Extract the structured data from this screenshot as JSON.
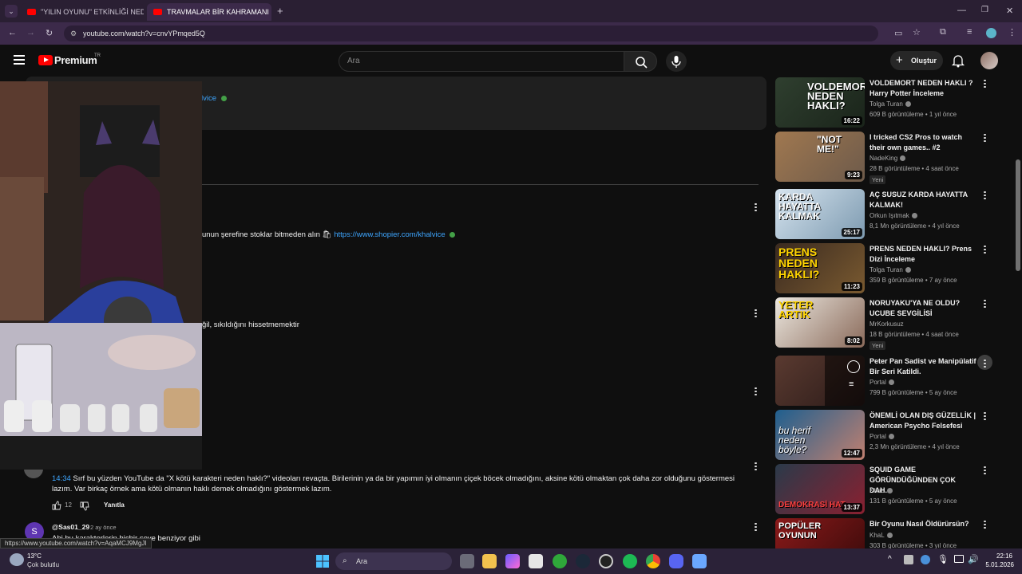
{
  "browser": {
    "tabs": [
      {
        "label": "\"YILIN OYUNU\" ETKİNLİĞİ NED..."
      },
      {
        "label": "TRAVMALAR BİR KAHRAMANI ..."
      }
    ],
    "url": "youtube.com/watch?v=cnvYPmqed5Q",
    "status_url": "https://www.youtube.com/watch?v=AqaMCJ9MgJI"
  },
  "youtube": {
    "logo": "Premium",
    "logo_region": "TR",
    "search_placeholder": "Ara",
    "create_label": "Oluştur"
  },
  "main": {
    "pinned_link_fragment": "lvice",
    "comment1_text": "unun şerefine stoklar bitmeden alın 🛍 ",
    "comment1_link": "https://www.shopier.com/khalvice",
    "comment2_text": "ğil, sıkıldığını  hissetmemektir",
    "comment3": {
      "timestamp": "14:34",
      "text": " Sırf bu yüzden YouTube da \"X kötü karakteri neden haklı?\" videoları revaçta. Birilerinin ya da bir yapımın iyi olmanın çiçek böcek olmadığını, aksine kötü olmaktan çok daha zor olduğunu göstermesi lazım. Var birkaç örnek ama kötü olmanın haklı demek olmadığını göstermek lazım.",
      "likes": "12",
      "reply_label": "Yanıtla"
    },
    "comment4": {
      "author": "@Sas01_29",
      "time": "2 ay önce",
      "avatar_letter": "S",
      "text": "Abi bu karakterlerin hiçbir şeye benziyor gibi"
    }
  },
  "sidebar": {
    "videos": [
      {
        "title": "VOLDEMORT NEDEN HAKLI ? Harry Potter İnceleme",
        "channel": "Tolga Turan",
        "meta": "609 B görüntüleme • 1 yıl önce",
        "duration": "16:22",
        "thumb_text": "VOLDEMORT NEDEN HAKLI?",
        "badge": ""
      },
      {
        "title": "I tricked CS2 Pros to watch their own games.. #2",
        "channel": "NadeKing",
        "meta": "28 B görüntüleme • 4 saat önce",
        "duration": "9:23",
        "thumb_text": "\"NOT ME!\"",
        "badge": "Yeni"
      },
      {
        "title": "AÇ SUSUZ KARDA HAYATTA KALMAK!",
        "channel": "Orkun Işıtmak",
        "meta": "8,1 Mn görüntüleme • 4 yıl önce",
        "duration": "25:17",
        "thumb_text": "KARDA HAYATTA KALMAK",
        "badge": ""
      },
      {
        "title": "PRENS NEDEN HAKLI? Prens Dizi İnceleme",
        "channel": "Tolga Turan",
        "meta": "359 B görüntüleme • 7 ay önce",
        "duration": "11:23",
        "thumb_text": "PRENS NEDEN HAKLI?",
        "badge": ""
      },
      {
        "title": "NORUYAKU'YA NE OLDU? UCUBE SEVGİLİSİ",
        "channel": "MrKorkusuz",
        "meta": "18 B görüntüleme • 4 saat önce",
        "duration": "8:02",
        "thumb_text": "YETER ARTIK",
        "badge": "Yeni"
      },
      {
        "title": "Peter Pan Sadist ve Manipülatif Bir Seri Katildi.",
        "channel": "Portal",
        "meta": "799 B görüntüleme • 5 ay önce",
        "duration": "",
        "thumb_text": "",
        "badge": ""
      },
      {
        "title": "ÖNEMLİ OLAN DIŞ GÜZELLİK | American Psycho Felsefesi",
        "channel": "Portal",
        "meta": "2,3 Mn görüntüleme • 4 yıl önce",
        "duration": "12:47",
        "thumb_text": "bu herif neden böyle?",
        "badge": ""
      },
      {
        "title": "SQUID GAME GÖRÜNDÜĞÜNDEN ÇOK DAH...",
        "channel": "KhaL",
        "meta": "131 B görüntüleme • 5 ay önce",
        "duration": "13:37",
        "thumb_text": "DEMOKRASİ HAT",
        "badge": ""
      },
      {
        "title": "Bir Oyunu Nasıl Öldürürsün?",
        "channel": "KhaL",
        "meta": "303 B görüntüleme • 3 yıl önce",
        "duration": "",
        "thumb_text": "POPÜLER OYUNUN",
        "badge": ""
      }
    ]
  },
  "taskbar": {
    "weather_temp": "13°C",
    "weather_desc": "Çok bulutlu",
    "search_label": "Ara",
    "time": "22:16",
    "date": "5.01.2026"
  }
}
